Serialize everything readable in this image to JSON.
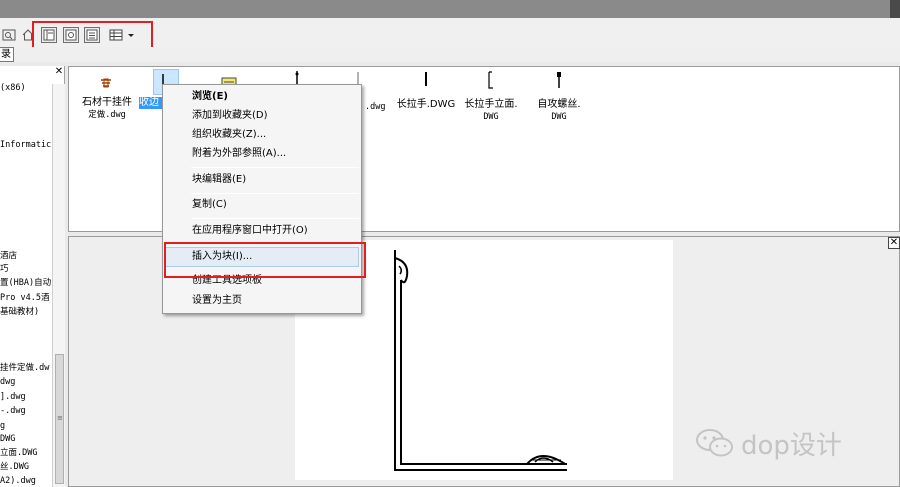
{
  "tab": {
    "label": "录"
  },
  "tree": {
    "lines": [
      "(x86)",
      "Informatic",
      "酒店",
      "巧",
      "置(HBA)自动",
      "Pro v4.5酒",
      "基础教材)",
      "挂件定做.dw",
      "dwg",
      "].dwg",
      "-.dwg",
      "g",
      "DWG",
      "立面.DWG",
      "丝.DWG",
      "A2).dwg"
    ]
  },
  "content": {
    "items": [
      {
        "line1": "石材干挂件",
        "line2": "定做.dwg"
      },
      {
        "line1": "收边"
      },
      {
        "line1": ".dwg"
      },
      {
        "line1": "长拉手.DWG"
      },
      {
        "line1": "长拉手立面.",
        "line2": "DWG"
      },
      {
        "line1": "自攻螺丝.",
        "line2": "DWG"
      }
    ]
  },
  "menu": {
    "items": [
      "浏览(E)",
      "添加到收藏夹(D)",
      "组织收藏夹(Z)...",
      "附着为外部参照(A)...",
      "块编辑器(E)",
      "复制(C)",
      "在应用程序窗口中打开(O)",
      "插入为块(I)...",
      "创建工具选项板",
      "设置为主页"
    ]
  },
  "watermark": {
    "text": "dop设计"
  },
  "colors": {
    "highlight": "#e02020",
    "selection": "#3399ff"
  }
}
